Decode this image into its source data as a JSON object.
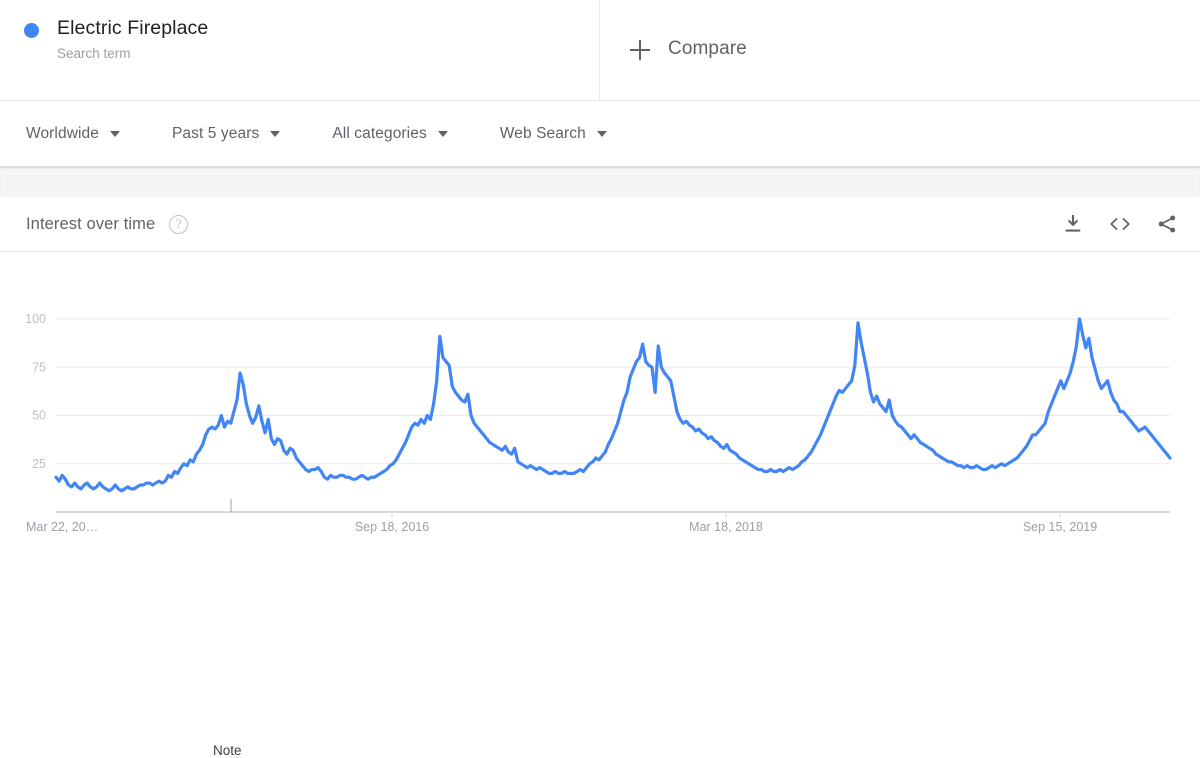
{
  "term": {
    "name": "Electric Fireplace",
    "subtitle": "Search term",
    "dot_color": "#4285f4"
  },
  "compare": {
    "label": "Compare",
    "icon": "plus-icon"
  },
  "filters": [
    {
      "label": "Worldwide",
      "icon": "chevron-down-icon"
    },
    {
      "label": "Past 5 years",
      "icon": "chevron-down-icon"
    },
    {
      "label": "All categories",
      "icon": "chevron-down-icon"
    },
    {
      "label": "Web Search",
      "icon": "chevron-down-icon"
    }
  ],
  "chart_header": {
    "title": "Interest over time",
    "help_icon": "?",
    "actions": [
      {
        "name": "download-icon"
      },
      {
        "name": "embed-code-icon"
      },
      {
        "name": "share-icon"
      }
    ]
  },
  "annotation": {
    "label": "Note"
  },
  "chart_data": {
    "type": "line",
    "title": "Interest over time",
    "xlabel": "",
    "ylabel": "",
    "ylim": [
      0,
      100
    ],
    "yticks": [
      25,
      50,
      75,
      100
    ],
    "xticks": [
      "Mar 22, 20…",
      "Sep 18, 2016",
      "Mar 18, 2018",
      "Sep 15, 2019"
    ],
    "grid": true,
    "legend": false,
    "line_color": "#4285f4",
    "series": [
      {
        "name": "Electric Fireplace",
        "values": [
          18,
          16,
          19,
          17,
          14,
          13,
          15,
          13,
          12,
          14,
          15,
          13,
          12,
          13,
          15,
          13,
          12,
          11,
          12,
          14,
          12,
          11,
          12,
          13,
          12,
          12,
          13,
          14,
          14,
          15,
          15,
          14,
          15,
          16,
          15,
          16,
          19,
          18,
          21,
          20,
          23,
          25,
          24,
          27,
          26,
          30,
          32,
          35,
          40,
          43,
          44,
          43,
          45,
          50,
          44,
          47,
          46,
          52,
          58,
          72,
          66,
          56,
          50,
          46,
          49,
          55,
          47,
          41,
          48,
          38,
          35,
          38,
          37,
          32,
          30,
          33,
          32,
          28,
          26,
          24,
          22,
          21,
          22,
          22,
          23,
          21,
          18,
          17,
          19,
          18,
          18,
          19,
          19,
          18,
          18,
          17,
          17,
          18,
          19,
          18,
          17,
          18,
          18,
          19,
          20,
          21,
          22,
          24,
          25,
          27,
          30,
          33,
          36,
          40,
          44,
          46,
          45,
          48,
          46,
          50,
          48,
          56,
          68,
          91,
          80,
          78,
          76,
          65,
          62,
          60,
          58,
          57,
          61,
          50,
          46,
          44,
          42,
          40,
          38,
          36,
          35,
          34,
          33,
          32,
          34,
          31,
          30,
          33,
          26,
          25,
          24,
          23,
          24,
          23,
          22,
          23,
          22,
          21,
          20,
          20,
          21,
          20,
          20,
          21,
          20,
          20,
          20,
          21,
          22,
          21,
          23,
          25,
          26,
          28,
          27,
          29,
          31,
          35,
          38,
          42,
          46,
          52,
          58,
          62,
          70,
          74,
          78,
          80,
          87,
          78,
          76,
          75,
          62,
          86,
          75,
          72,
          70,
          68,
          60,
          52,
          48,
          46,
          47,
          45,
          44,
          42,
          43,
          41,
          40,
          38,
          39,
          37,
          36,
          34,
          33,
          35,
          32,
          31,
          30,
          28,
          27,
          26,
          25,
          24,
          23,
          22,
          22,
          21,
          21,
          22,
          21,
          21,
          22,
          21,
          22,
          23,
          22,
          23,
          24,
          26,
          27,
          29,
          31,
          34,
          37,
          40,
          44,
          48,
          52,
          56,
          60,
          63,
          62,
          64,
          66,
          68,
          76,
          98,
          88,
          80,
          72,
          62,
          57,
          60,
          56,
          54,
          52,
          58,
          50,
          47,
          45,
          44,
          42,
          40,
          38,
          40,
          38,
          36,
          35,
          34,
          33,
          32,
          30,
          29,
          28,
          27,
          26,
          26,
          25,
          24,
          24,
          23,
          24,
          23,
          23,
          24,
          23,
          22,
          22,
          23,
          24,
          23,
          24,
          25,
          24,
          25,
          26,
          27,
          28,
          30,
          32,
          34,
          37,
          40,
          40,
          42,
          44,
          46,
          52,
          56,
          60,
          64,
          68,
          64,
          68,
          72,
          78,
          86,
          100,
          92,
          85,
          90,
          80,
          74,
          68,
          64,
          66,
          68,
          62,
          58,
          56,
          52,
          52,
          50,
          48,
          46,
          44,
          42,
          43,
          44,
          42,
          40,
          38,
          36,
          34,
          32,
          30,
          28
        ]
      }
    ]
  }
}
